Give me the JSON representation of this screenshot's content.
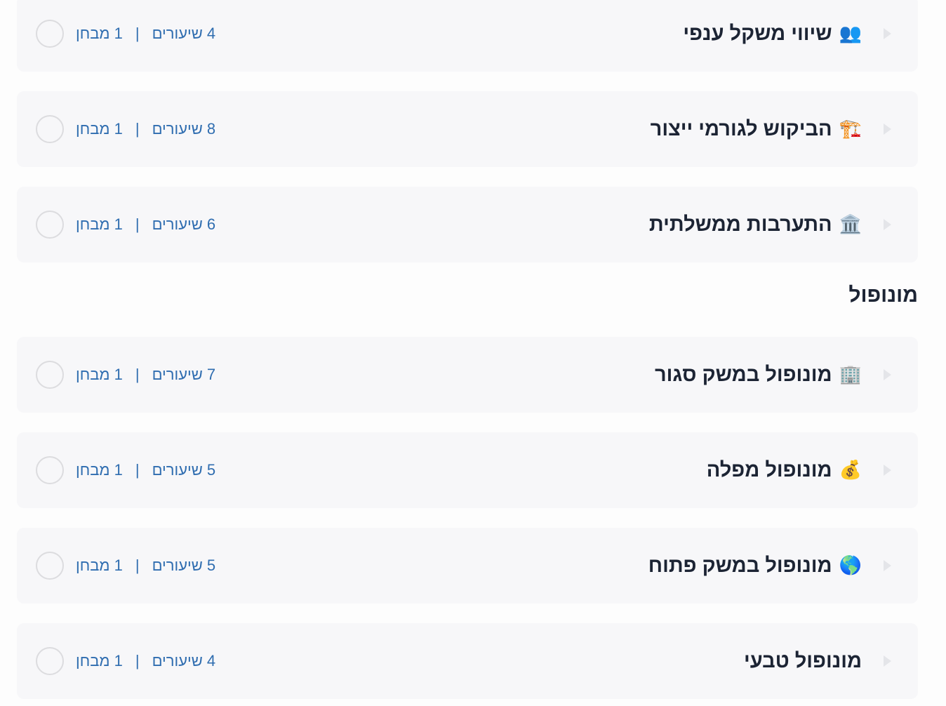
{
  "sections": [
    {
      "heading": "",
      "units": [
        {
          "emoji": "👥",
          "icon": "people-icon",
          "title": "שיווי משקל ענפי",
          "lessons": "4 שיעורים",
          "exams": "1 מבחן"
        },
        {
          "emoji": "🏗️",
          "icon": "crane-icon",
          "title": "הביקוש לגורמי ייצור",
          "lessons": "8 שיעורים",
          "exams": "1 מבחן"
        },
        {
          "emoji": "🏛️",
          "icon": "government-building-icon",
          "title": "התערבות ממשלתית",
          "lessons": "6 שיעורים",
          "exams": "1 מבחן"
        }
      ]
    },
    {
      "heading": "מונופול",
      "units": [
        {
          "emoji": "🏢",
          "icon": "office-building-icon",
          "title": "מונופול במשק סגור",
          "lessons": "7 שיעורים",
          "exams": "1 מבחן"
        },
        {
          "emoji": "💰",
          "icon": "money-bag-icon",
          "title": "מונופול מפלה",
          "lessons": "5 שיעורים",
          "exams": "1 מבחן"
        },
        {
          "emoji": "🌎",
          "icon": "globe-icon",
          "title": "מונופול במשק פתוח",
          "lessons": "5 שיעורים",
          "exams": "1 מבחן"
        },
        {
          "emoji": "",
          "icon": "",
          "title": "מונופול טבעי",
          "lessons": "4 שיעורים",
          "exams": "1 מבחן"
        }
      ]
    }
  ],
  "separator": "|",
  "colors": {
    "card_bg": "#f7f7f9",
    "title": "#1c2434",
    "meta": "#2f6db0",
    "circle": "#dcdcdf",
    "chevron": "#e4e5e9"
  }
}
